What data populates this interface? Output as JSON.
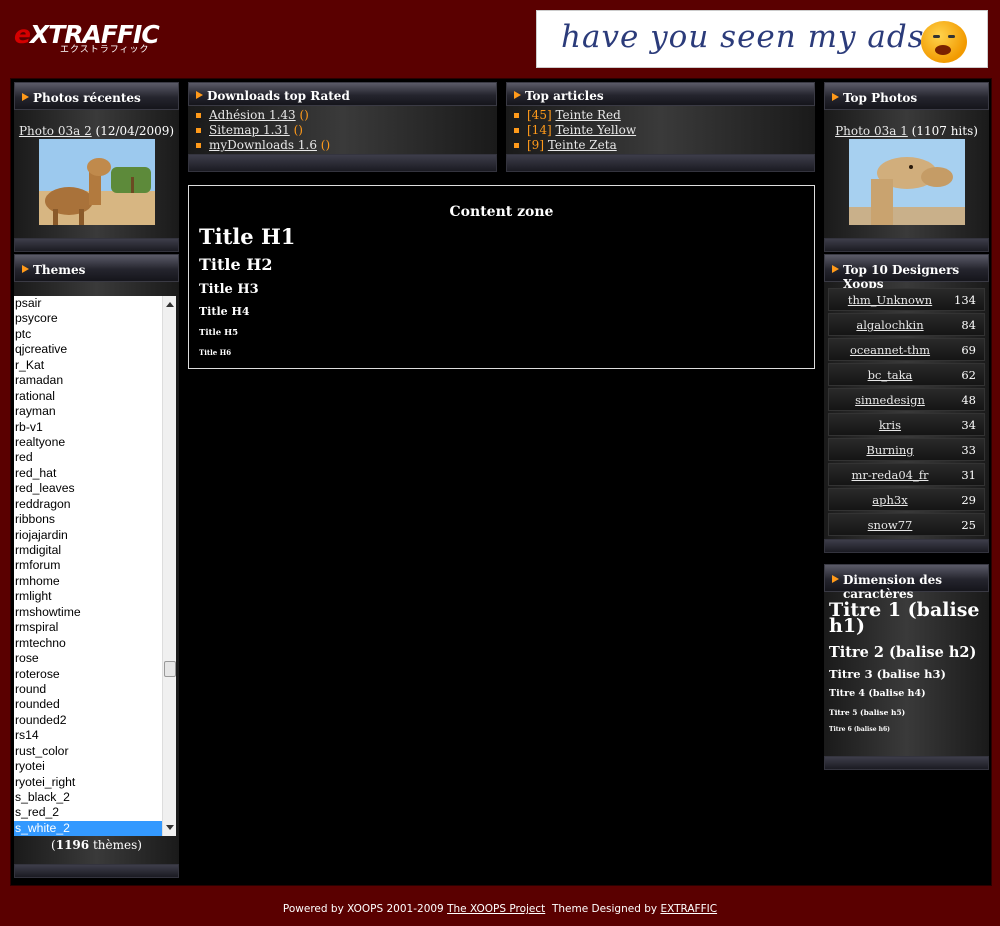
{
  "header": {
    "logo_big": "TRAFFIC",
    "logo_e": "e",
    "logo_x": "X",
    "logo_kana": "エクストラフィック",
    "ad_text": "have you seen my ads ?"
  },
  "photos_recentes": {
    "title": "Photos récentes",
    "link": "Photo 03a 2",
    "date": "(12/04/2009)"
  },
  "themes": {
    "title": "Themes",
    "options": [
      "psair",
      "psycore",
      "ptc",
      "qjcreative",
      "r_Kat",
      "ramadan",
      "rational",
      "rayman",
      "rb-v1",
      "realtyone",
      "red",
      "red_hat",
      "red_leaves",
      "reddragon",
      "ribbons",
      "riojajardin",
      "rmdigital",
      "rmforum",
      "rmhome",
      "rmlight",
      "rmshowtime",
      "rmspiral",
      "rmtechno",
      "rose",
      "roterose",
      "round",
      "rounded",
      "rounded2",
      "rs14",
      "rust_color",
      "ryotei",
      "ryotei_right",
      "s_black_2",
      "s_red_2",
      "s_white_2"
    ],
    "selected": "s_white_2",
    "count_open": "(",
    "count": "1196",
    "count_label": " thèmes)"
  },
  "downloads": {
    "title": "Downloads top Rated",
    "items": [
      {
        "label": "Adhésion 1.43",
        "suffix": "()"
      },
      {
        "label": "Sitemap 1.31",
        "suffix": "()"
      },
      {
        "label": "myDownloads 1.6",
        "suffix": "()"
      }
    ]
  },
  "articles": {
    "title": "Top articles",
    "items": [
      {
        "count": "[45]",
        "label": "Teinte Red"
      },
      {
        "count": "[14]",
        "label": "Teinte Yellow"
      },
      {
        "count": "[9]",
        "label": "Teinte Zeta"
      }
    ]
  },
  "content": {
    "zone_title": "Content zone",
    "h1": "Title H1",
    "h2": "Title H2",
    "h3": "Title H3",
    "h4": "Title H4",
    "h5": "Title H5",
    "h6": "Title H6"
  },
  "top_photos": {
    "title": "Top Photos",
    "link": "Photo 03a 1",
    "hits": "(1107 hits)"
  },
  "top_designers": {
    "title": "Top 10 Designers Xoops",
    "rows": [
      {
        "name": "thm_Unknown",
        "count": "134"
      },
      {
        "name": "algalochkin",
        "count": "84"
      },
      {
        "name": "oceannet-thm",
        "count": "69"
      },
      {
        "name": "bc_taka",
        "count": "62"
      },
      {
        "name": "sinnedesign",
        "count": "48"
      },
      {
        "name": "kris",
        "count": "34"
      },
      {
        "name": "Burning",
        "count": "33"
      },
      {
        "name": "mr-reda04_fr",
        "count": "31"
      },
      {
        "name": "aph3x",
        "count": "29"
      },
      {
        "name": "snow77",
        "count": "25"
      }
    ]
  },
  "dimension": {
    "title": "Dimension des caractères",
    "t1": "Titre 1 (balise h1)",
    "t2": "Titre 2 (balise h2)",
    "t3": "Titre 3 (balise h3)",
    "t4": "Titre 4 (balise h4)",
    "t5": "Titre 5 (balise h5)",
    "t6": "Titre 6 (balise h6)"
  },
  "footer": {
    "prefix": "Powered by XOOPS 2001-2009 ",
    "xoops_link": "The XOOPS Project",
    "middle": "  Theme Designed by ",
    "designer_link": "EXTRAFFIC"
  },
  "colors": {
    "background": "#5a0000",
    "accent": "#ff9a1a",
    "selection": "#3399ff"
  }
}
